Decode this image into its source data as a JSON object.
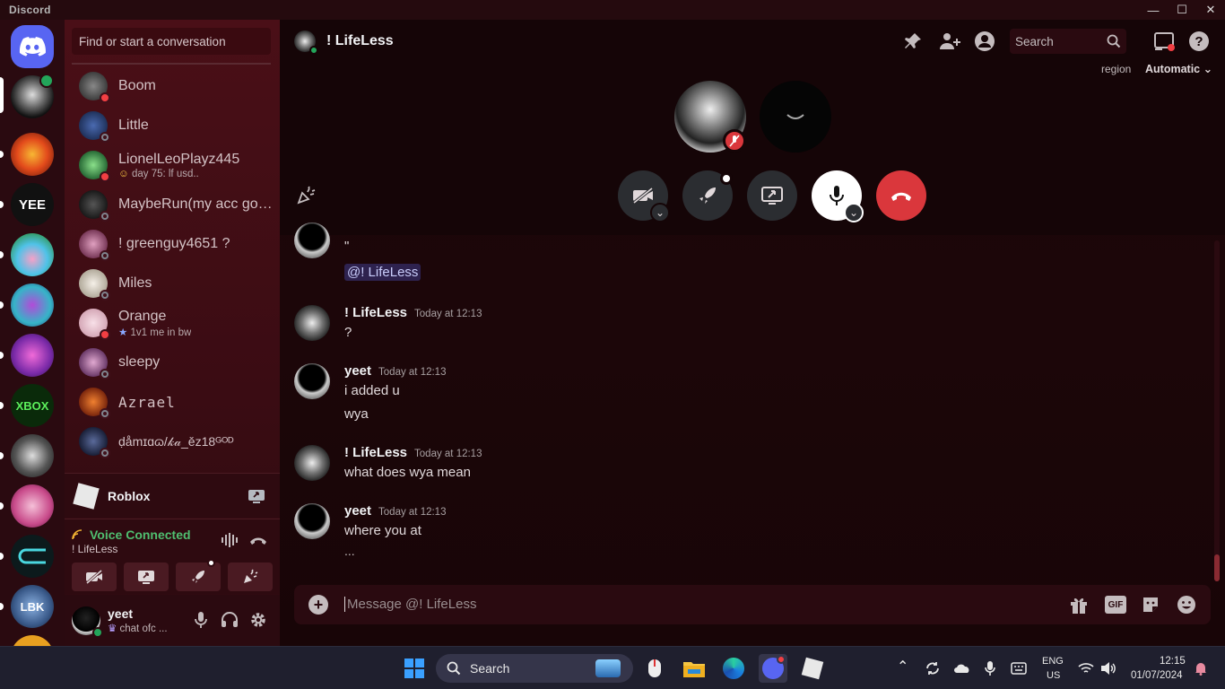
{
  "window": {
    "title": "Discord",
    "minimize": "—",
    "maximize": "☐",
    "close": "✕"
  },
  "dm_search": {
    "placeholder": "Find or start a conversation"
  },
  "dms": [
    {
      "name": "Boom",
      "sub": "",
      "status": "dnd"
    },
    {
      "name": "Little",
      "sub": "",
      "status": "off"
    },
    {
      "name": "LionelLeoPlayz445",
      "sub": "day 75: lf usd..",
      "status": "dnd"
    },
    {
      "name": "MaybeRun(my acc got...",
      "sub": "",
      "status": "off"
    },
    {
      "name": "! greenguy4651 ?",
      "sub": "",
      "status": "off"
    },
    {
      "name": "Miles",
      "sub": "",
      "status": "off"
    },
    {
      "name": "Orange",
      "sub": "1v1 me in bw",
      "status": "dnd"
    },
    {
      "name": "sleepy",
      "sub": "",
      "status": "off"
    },
    {
      "name": "Azrael",
      "sub": "",
      "status": "off"
    },
    {
      "name": "ḍåmɪɑɷ/𝓀𝒶_ěz18ᴳᴼᴰ",
      "sub": "",
      "status": "off"
    }
  ],
  "activity": {
    "game": "Roblox"
  },
  "voice": {
    "status": "Voice Connected",
    "channel": "! LifeLess"
  },
  "user": {
    "name": "yeet",
    "status": "chat ofc ..."
  },
  "chat": {
    "recipient": "! LifeLess",
    "region_label": "region",
    "region_value": "Automatic",
    "search_placeholder": "Search",
    "mention": "@! LifeLess",
    "partial_quote": "\"",
    "composer_placeholder": "Message @! LifeLess",
    "typing": "...",
    "gif_label": "GIF"
  },
  "messages": [
    {
      "author": "! LifeLess",
      "time": "Today at 12:13",
      "lines": [
        "?"
      ]
    },
    {
      "author": "yeet",
      "time": "Today at 12:13",
      "lines": [
        "i added u",
        "wya"
      ]
    },
    {
      "author": "! LifeLess",
      "time": "Today at 12:13",
      "lines": [
        "what does wya mean"
      ]
    },
    {
      "author": "yeet",
      "time": "Today at 12:13",
      "lines": [
        "where you at"
      ]
    }
  ],
  "taskbar": {
    "search": "Search",
    "lang_top": "ENG",
    "lang_bottom": "US",
    "time": "12:15",
    "date": "01/07/2024"
  },
  "colors": {
    "accent": "#5865f2",
    "danger": "#da373c",
    "online": "#23a55a",
    "voice_green": "#4fbf70"
  }
}
